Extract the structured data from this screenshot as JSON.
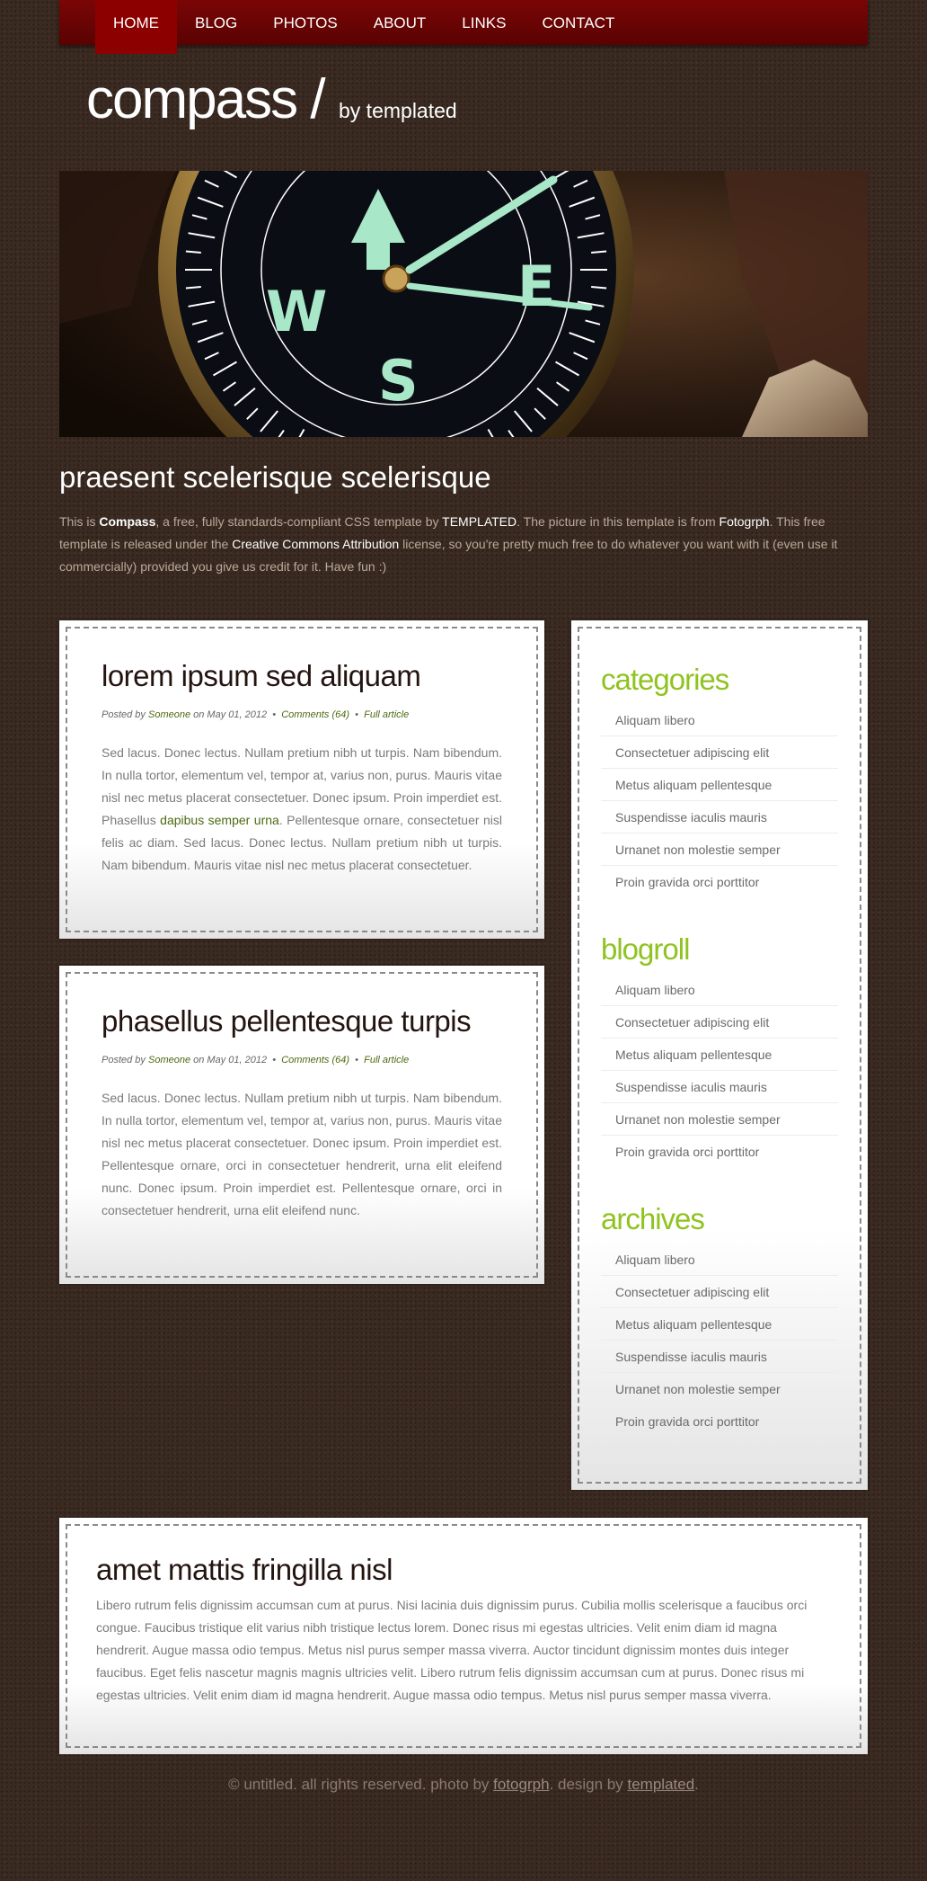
{
  "nav": [
    "HOME",
    "BLOG",
    "PHOTOS",
    "ABOUT",
    "LINKS",
    "CONTACT"
  ],
  "logo": {
    "title": "compass /",
    "tagline": "by templated"
  },
  "intro": {
    "heading": "praesent scelerisque scelerisque",
    "t1": "This is ",
    "b1": "Compass",
    "t2": ", a free, fully standards-compliant CSS template by ",
    "w1": "TEMPLATED",
    "t3": ". The picture in this template is from ",
    "w2": "Fotogrph",
    "t4": ". This free template is released under the ",
    "w3": "Creative Commons Attribution",
    "t5": " license, so you're pretty much free to do whatever you want with it (even use it commercially) provided you give us credit for it. Have fun :)"
  },
  "posts": [
    {
      "title": "lorem ipsum sed aliquam",
      "posted_by": "Posted by",
      "author": "Someone",
      "on": "on May 01, 2012",
      "sep": "•",
      "comments": "Comments (64)",
      "full": "Full article",
      "p1": "Sed lacus. Donec lectus. Nullam pretium nibh ut turpis. Nam bibendum. In nulla tortor, elementum vel, tempor at, varius non, purus. Mauris vitae nisl nec metus placerat consectetuer. Donec ipsum. Proin imperdiet est. Phasellus ",
      "link": "dapibus semper urna",
      "p2": ". Pellentesque ornare, consectetuer nisl felis ac diam. Sed lacus. Donec lectus. Nullam pretium nibh ut turpis. Nam bibendum. Mauris vitae nisl nec metus placerat consectetuer."
    },
    {
      "title": "phasellus pellentesque turpis",
      "posted_by": "Posted by",
      "author": "Someone",
      "on": "on May 01, 2012",
      "sep": "•",
      "comments": "Comments (64)",
      "full": "Full article",
      "p1": "Sed lacus. Donec lectus. Nullam pretium nibh ut turpis. Nam bibendum. In nulla tortor, elementum vel, tempor at, varius non, purus. Mauris vitae nisl nec metus placerat consectetuer. Donec ipsum. Proin imperdiet est. Pellentesque ornare, orci in consectetuer hendrerit, urna elit eleifend nunc. Donec ipsum. Proin imperdiet est. Pellentesque ornare, orci in consectetuer hendrerit, urna elit eleifend nunc."
    }
  ],
  "sidebar": [
    {
      "title": "categories",
      "items": [
        "Aliquam libero",
        "Consectetuer adipiscing elit",
        "Metus aliquam pellentesque",
        "Suspendisse iaculis mauris",
        "Urnanet non molestie semper",
        "Proin gravida orci porttitor"
      ]
    },
    {
      "title": "blogroll",
      "items": [
        "Aliquam libero",
        "Consectetuer adipiscing elit",
        "Metus aliquam pellentesque",
        "Suspendisse iaculis mauris",
        "Urnanet non molestie semper",
        "Proin gravida orci porttitor"
      ]
    },
    {
      "title": "archives",
      "items": [
        "Aliquam libero",
        "Consectetuer adipiscing elit",
        "Metus aliquam pellentesque",
        "Suspendisse iaculis mauris",
        "Urnanet non molestie semper",
        "Proin gravida orci porttitor"
      ]
    }
  ],
  "bottom": {
    "title": "amet mattis fringilla nisl",
    "body": "Libero rutrum felis dignissim accumsan cum at purus. Nisi lacinia duis dignissim purus. Cubilia mollis scelerisque a faucibus orci congue. Faucibus tristique elit varius nibh tristique lectus lorem. Donec risus mi egestas ultricies. Velit enim diam id magna hendrerit. Augue massa odio tempus. Metus nisl purus semper massa viverra. Auctor tincidunt dignissim montes duis integer faucibus. Eget felis nascetur magnis magnis ultricies velit. Libero rutrum felis dignissim accumsan cum at purus. Donec risus mi egestas ultricies. Velit enim diam id magna hendrerit. Augue massa odio tempus. Metus nisl purus semper massa viverra."
  },
  "footer": {
    "t1": "© untitled. all rights reserved. photo by ",
    "l1": "fotogrph",
    "t2": ". design by ",
    "l2": "templated",
    "t3": "."
  },
  "colors": {
    "nav": "#6a0404",
    "accent_green": "#8fc31f",
    "link_green": "#4c6a10",
    "background": "#3a2a21"
  }
}
